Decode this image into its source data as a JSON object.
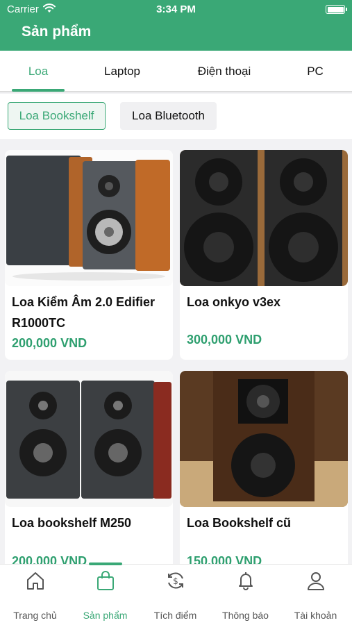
{
  "status_bar": {
    "carrier": "Carrier",
    "time": "3:34 PM"
  },
  "header": {
    "title": "Sản phẩm"
  },
  "tabs": [
    {
      "label": "Loa",
      "active": true
    },
    {
      "label": "Laptop",
      "active": false
    },
    {
      "label": "Điện thoại",
      "active": false
    },
    {
      "label": "PC",
      "active": false
    }
  ],
  "chips": [
    {
      "label": "Loa Bookshelf",
      "selected": true
    },
    {
      "label": "Loa Bluetooth",
      "selected": false
    }
  ],
  "products": [
    {
      "name": "Loa Kiểm Âm 2.0 Edifier R1000TC",
      "price": "200,000 VND"
    },
    {
      "name": "Loa onkyo v3ex",
      "price": "300,000 VND"
    },
    {
      "name": "Loa bookshelf M250",
      "price": "200,000 VND"
    },
    {
      "name": "Loa Bookshelf cũ",
      "price": "150,000 VND"
    }
  ],
  "bottom_nav": [
    {
      "label": "Trang chủ",
      "icon": "home-icon",
      "active": false
    },
    {
      "label": "Sản phẩm",
      "icon": "shopping-bag-icon",
      "active": true
    },
    {
      "label": "Tích điểm",
      "icon": "points-exchange-icon",
      "active": false
    },
    {
      "label": "Thông báo",
      "icon": "bell-icon",
      "active": false
    },
    {
      "label": "Tài khoản",
      "icon": "user-icon",
      "active": false
    }
  ],
  "colors": {
    "brand": "#3aa876",
    "price": "#2e9f6f"
  }
}
